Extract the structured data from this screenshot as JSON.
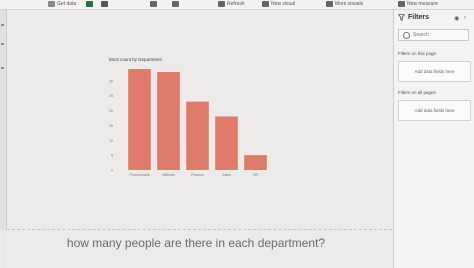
{
  "toolbar": {
    "items": [
      {
        "label": "Get data",
        "icon": "database-icon",
        "color": "#666666"
      },
      {
        "label": "",
        "icon": "excel-icon",
        "color": "#217346"
      },
      {
        "label": "",
        "icon": "dataverse-icon",
        "color": "#555555"
      },
      {
        "label": "",
        "icon": "table-icon",
        "color": "#555555"
      },
      {
        "label": "",
        "icon": "refresh-icon",
        "color": "#555555"
      },
      {
        "label": "Refresh",
        "icon": "refresh-icon",
        "color": "#555555"
      },
      {
        "label": "New visual",
        "icon": "chart-icon",
        "color": "#555555"
      },
      {
        "label": "More visuals",
        "icon": "grid-icon",
        "color": "#555555"
      },
      {
        "label": "New measure",
        "icon": "calculator-icon",
        "color": "#555555"
      }
    ]
  },
  "chart_data": {
    "type": "bar",
    "title": "Most count by Department",
    "categories": [
      "Procurement",
      "Website",
      "Finance",
      "Sales",
      "HR"
    ],
    "values": [
      34,
      33,
      23,
      18,
      5
    ],
    "ylim": [
      0,
      35
    ],
    "yticks": [
      0,
      5,
      10,
      15,
      20,
      25,
      30
    ],
    "ytick_labels": [
      "0",
      "5",
      "10",
      "15",
      "20",
      "25",
      "30"
    ],
    "xlabel": "",
    "ylabel": "",
    "grid": false,
    "bar_color": "#e07a6b"
  },
  "qa": {
    "question": "how many people are there in each department?"
  },
  "filters": {
    "title": "Filters",
    "search_placeholder": "Search",
    "sections": [
      {
        "label": "Filters on this page",
        "dropzone": "Add data fields here"
      },
      {
        "label": "Filters on all pages",
        "dropzone": "Add data fields here"
      }
    ]
  }
}
